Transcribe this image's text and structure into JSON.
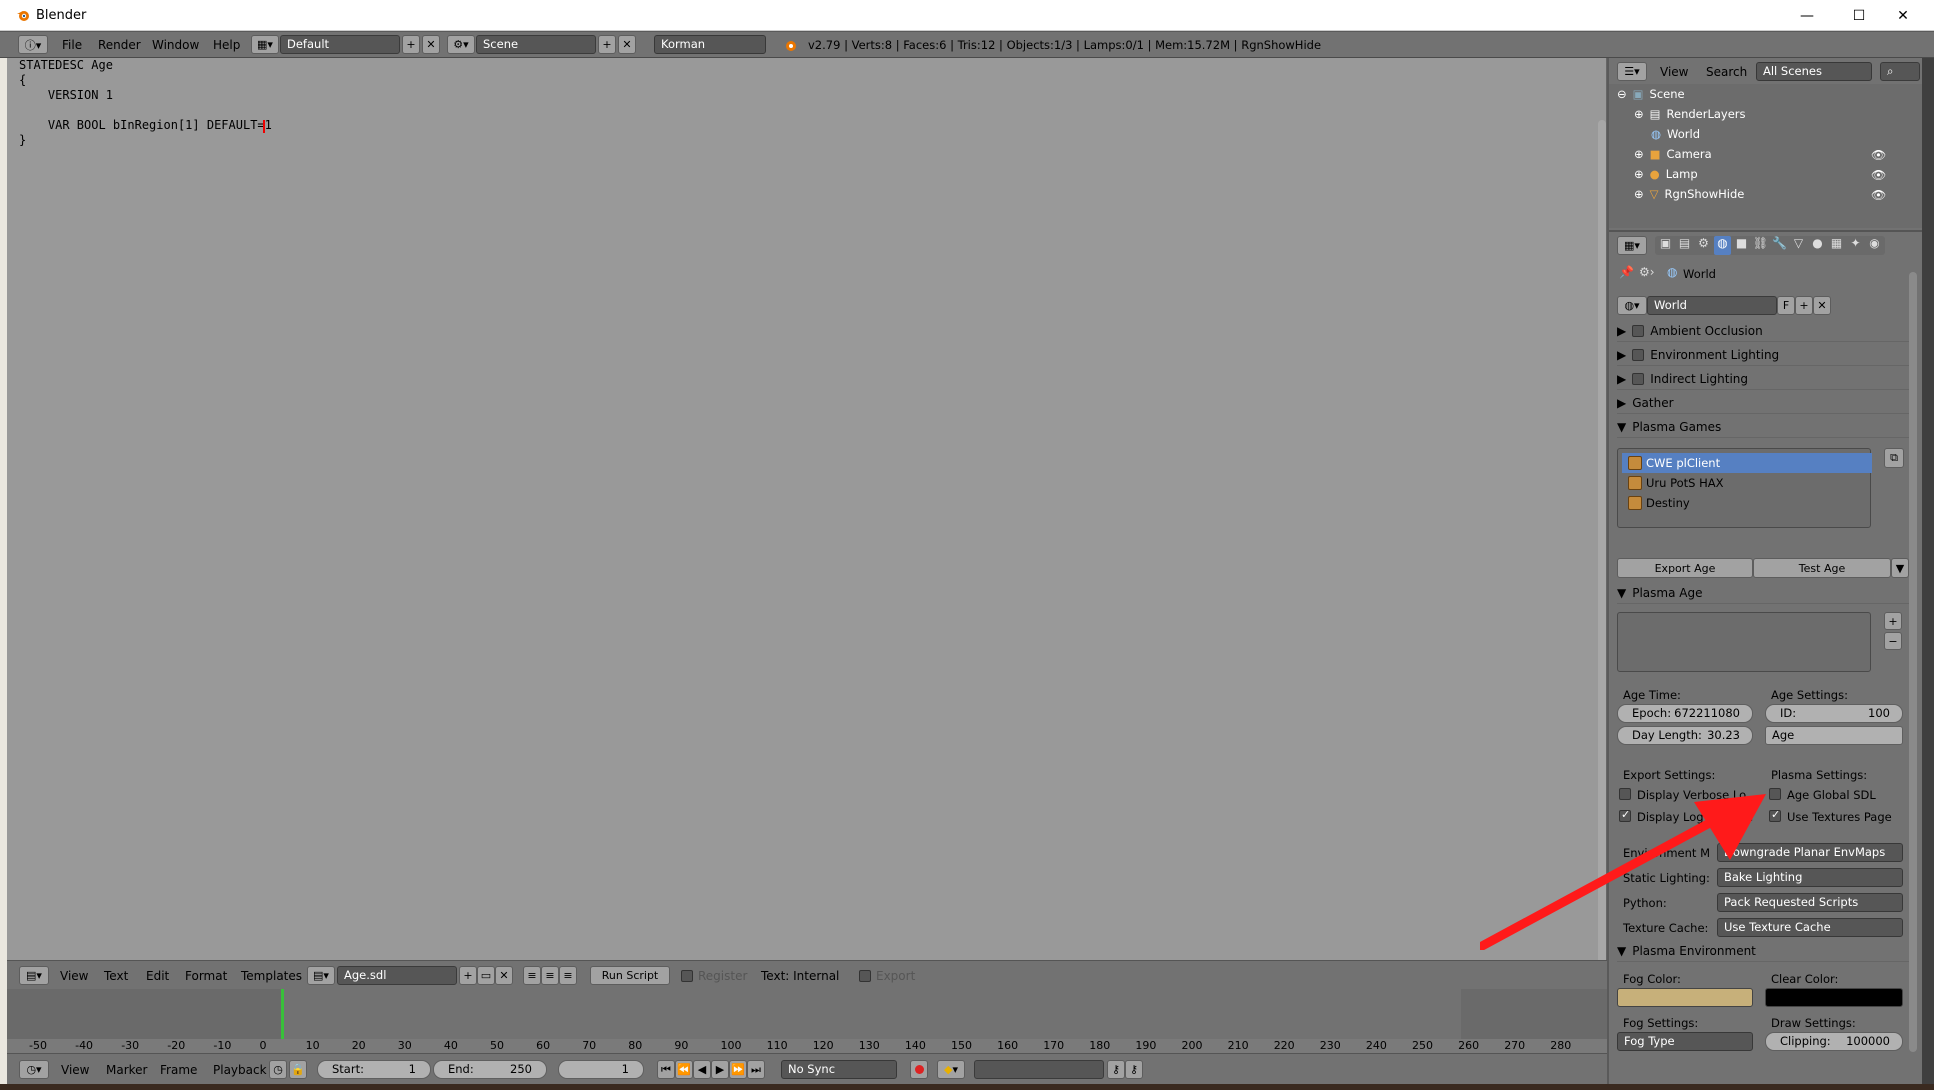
{
  "window": {
    "title": "Blender"
  },
  "infobar": {
    "menus": [
      "File",
      "Render",
      "Window",
      "Help"
    ],
    "layout": "Default",
    "scene": "Scene",
    "engine": "Korman",
    "stats": "v2.79 | Verts:8 | Faces:6 | Tris:12 | Objects:1/3 | Lamps:0/1 | Mem:15.72M | RgnShowHide"
  },
  "text_editor": {
    "lines": [
      "STATEDESC Age",
      "{",
      "    VERSION 1",
      "",
      "    VAR BOOL bInRegion[1] DEFAULT=1",
      "}"
    ],
    "header": {
      "menus": [
        "View",
        "Text",
        "Edit",
        "Format",
        "Templates"
      ],
      "file": "Age.sdl",
      "run_script": "Run Script",
      "register": "Register",
      "text_internal": "Text: Internal",
      "export": "Export"
    }
  },
  "timeline": {
    "ticks": [
      "-50",
      "-40",
      "-30",
      "-20",
      "-10",
      "0",
      "10",
      "20",
      "30",
      "40",
      "50",
      "60",
      "70",
      "80",
      "90",
      "100",
      "110",
      "120",
      "130",
      "140",
      "150",
      "160",
      "170",
      "180",
      "190",
      "200",
      "210",
      "220",
      "230",
      "240",
      "250",
      "260",
      "270",
      "280"
    ],
    "current_frame": 1,
    "header": {
      "menus": [
        "View",
        "Marker",
        "Frame",
        "Playback"
      ],
      "start_label": "Start:",
      "start": "1",
      "end_label": "End:",
      "end": "250",
      "frame": "1",
      "sync": "No Sync"
    }
  },
  "outliner": {
    "view": "View",
    "search": "Search",
    "filter": "All Scenes",
    "items": [
      "Scene",
      "RenderLayers",
      "World",
      "Camera",
      "Lamp",
      "RgnShowHide"
    ]
  },
  "properties": {
    "breadcrumb": "World",
    "world_field": "World",
    "world_f": "F",
    "sections": [
      "Ambient Occlusion",
      "Environment Lighting",
      "Indirect Lighting",
      "Gather",
      "Plasma Games"
    ],
    "games": [
      "CWE plClient",
      "Uru PotS HAX",
      "Destiny"
    ],
    "export_age": "Export Age",
    "test_age": "Test Age",
    "plasma_age": "Plasma Age",
    "age_time": "Age Time:",
    "age_settings": "Age Settings:",
    "epoch_label": "Epoch:",
    "epoch": "672211080",
    "id_label": "ID:",
    "id": "100",
    "day_length_label": "Day Length:",
    "day_length": "30.23",
    "age_name": "Age",
    "export_settings": "Export Settings:",
    "plasma_settings": "Plasma Settings:",
    "display_verbose": "Display Verbose Lo",
    "display_log": "Display Log Console",
    "age_global_sdl": "Age Global SDL",
    "use_textures_page": "Use Textures Page",
    "env_map_label": "Environment M",
    "env_map": "Downgrade Planar EnvMaps",
    "static_lighting_label": "Static Lighting:",
    "static_lighting": "Bake Lighting",
    "python_label": "Python:",
    "python": "Pack Requested Scripts",
    "texture_cache_label": "Texture Cache:",
    "texture_cache": "Use Texture Cache",
    "plasma_environment": "Plasma Environment",
    "fog_color": "Fog Color:",
    "clear_color": "Clear Color:",
    "fog_settings": "Fog Settings:",
    "draw_settings": "Draw Settings:",
    "fog_type": "Fog Type",
    "clipping_label": "Clipping:",
    "clipping": "100000"
  },
  "colors": {
    "fog": "#c7b07a",
    "clear": "#000000",
    "annotation": "#ff1a1a"
  }
}
